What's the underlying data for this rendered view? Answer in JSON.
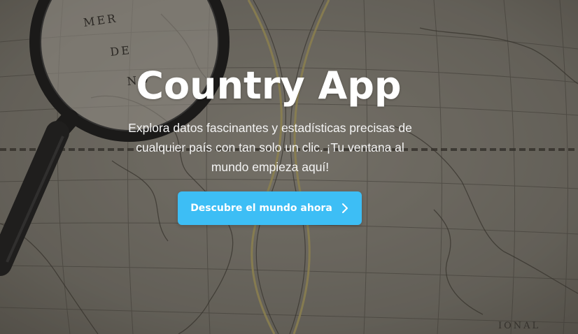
{
  "hero": {
    "title": "Country App",
    "subtitle": "Explora datos fascinantes y estadísticas precisas de cualquier país con tan solo un clic. ¡Tu ventana al mundo empieza aquí!",
    "cta_label": "Descubre el mundo ahora",
    "cta_icon": "chevron-right-icon",
    "map_text": [
      "MER",
      "DE",
      "NO",
      "IONAL"
    ]
  },
  "colors": {
    "accent": "#3dbef5",
    "text": "#ffffff",
    "map_base": "#8e8a80",
    "map_line": "#3e3a33",
    "meridian": "#c9b86a"
  }
}
